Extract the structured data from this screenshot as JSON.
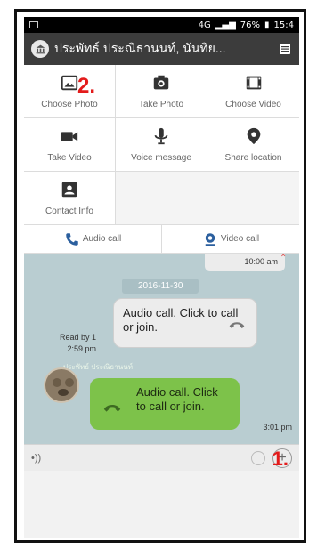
{
  "status_bar": {
    "indicators": "4G",
    "battery": "76%",
    "time": "15:4"
  },
  "header": {
    "title": "ประพัทธ์ ประณิธานนท์, นันทิย...",
    "icons": [
      "home-icon",
      "menu-icon"
    ]
  },
  "actions": [
    {
      "label": "Choose Photo",
      "icon": "photo-icon"
    },
    {
      "label": "Take Photo",
      "icon": "camera-icon"
    },
    {
      "label": "Choose Video",
      "icon": "film-icon"
    },
    {
      "label": "Take Video",
      "icon": "video-camera-icon"
    },
    {
      "label": "Voice message",
      "icon": "microphone-icon"
    },
    {
      "label": "Share location",
      "icon": "location-pin-icon"
    },
    {
      "label": "Contact Info",
      "icon": "contact-icon"
    }
  ],
  "calls": {
    "audio": "Audio call",
    "video": "Video call"
  },
  "annotations": {
    "step1": "1.",
    "step2": "2."
  },
  "chat": {
    "top_time": "10:00 am",
    "date": "2016-11-30",
    "incoming": {
      "text": "Audio call. Click to call or join.",
      "read": "Read by 1",
      "time": "2:59 pm"
    },
    "sender_name": "ประพัทธ์ ประณิธานนท์",
    "outgoing": {
      "text": "Audio call. Click to call or join.",
      "time": "3:01 pm"
    }
  },
  "colors": {
    "header": "#3c3c3c",
    "chat_bg": "#b9cdd1",
    "out_bubble": "#7dc24a",
    "annotation": "#e31b1b"
  }
}
